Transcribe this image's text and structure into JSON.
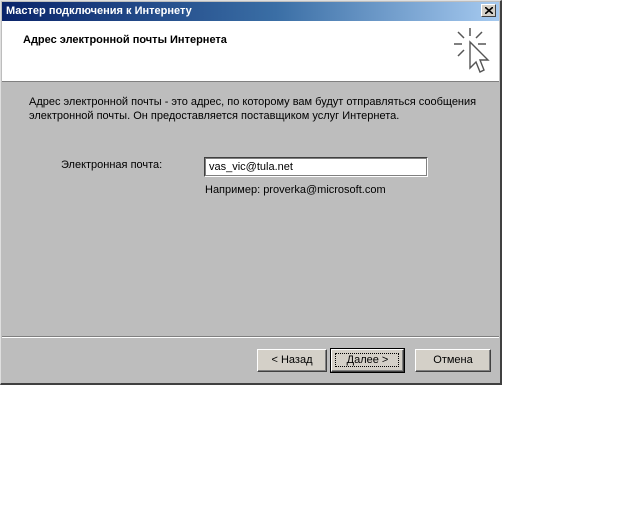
{
  "window": {
    "title": "Мастер подключения к Интернету",
    "close_symbol": "×"
  },
  "header": {
    "title": "Адрес электронной почты Интернета",
    "icon": "wizard-cursor-icon"
  },
  "content": {
    "description": "Адрес электронной почты - это адрес, по которому вам будут отправляться сообщения электронной почты. Он предоставляется поставщиком услуг Интернета.",
    "email_label": "Электронная почта:",
    "email_value": "vas_vic@tula.net",
    "example": "Например: proverka@microsoft.com"
  },
  "buttons": {
    "back": "< Назад",
    "next": "Далее >",
    "cancel": "Отмена"
  }
}
